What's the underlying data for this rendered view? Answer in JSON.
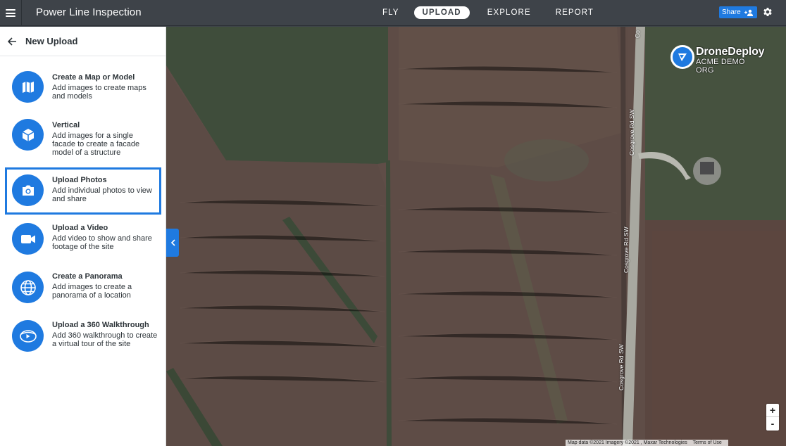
{
  "app": {
    "title": "Power Line Inspection"
  },
  "nav": {
    "tabs": [
      "FLY",
      "UPLOAD",
      "EXPLORE",
      "REPORT"
    ],
    "active": "UPLOAD"
  },
  "header": {
    "share_label": "Share"
  },
  "panel": {
    "title": "New Upload",
    "options": [
      {
        "title": "Create a Map or Model",
        "desc": "Add images to create maps and models",
        "icon": "map-icon"
      },
      {
        "title": "Vertical",
        "desc": "Add images for a single facade to create a facade model of a structure",
        "icon": "cube-icon"
      },
      {
        "title": "Upload Photos",
        "desc": "Add individual photos to view and share",
        "icon": "camera-icon",
        "selected": true
      },
      {
        "title": "Upload a Video",
        "desc": "Add video to show and share footage of the site",
        "icon": "video-icon"
      },
      {
        "title": "Create a Panorama",
        "desc": "Add images to create a panorama of a location",
        "icon": "globe-icon"
      },
      {
        "title": "Upload a 360 Walkthrough",
        "desc": "Add 360 walkthrough to create a virtual tour of the site",
        "icon": "360-walkthrough-icon"
      }
    ]
  },
  "map": {
    "logo_brand": "DroneDeploy",
    "logo_org": "ACME DEMO ORG",
    "road_labels": [
      "Cosgrove Rd SW",
      "Cosgrove Rd SW",
      "Cosgrove Rd SW",
      "Co"
    ],
    "zoom_in": "+",
    "zoom_out": "-",
    "attribution": "Map data ©2021 Imagery ©2021 , Maxar Technologies",
    "terms": "Terms of Use"
  },
  "colors": {
    "accent": "#1f7ae0",
    "topbar": "#3e4349"
  }
}
